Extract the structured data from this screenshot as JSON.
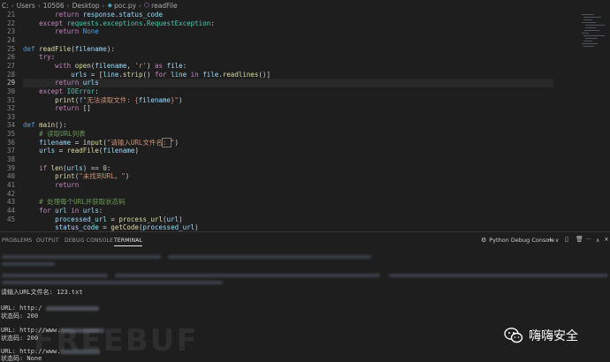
{
  "breadcrumb": {
    "items": [
      "C:",
      "Users",
      "10506",
      "Desktop",
      "poc.py",
      "readFile"
    ]
  },
  "editor": {
    "line_numbers": [
      "21",
      "22",
      "23",
      "24",
      "25",
      "26",
      "27",
      "28",
      "29",
      "30",
      "31",
      "32",
      "33",
      "34",
      "35",
      "36",
      "37",
      "38",
      "39",
      "40",
      "41",
      "42",
      "43",
      "44",
      "45"
    ],
    "current_line": "29"
  },
  "panel": {
    "tabs": [
      "PROBLEMS",
      "OUTPUT",
      "DEBUG CONSOLE",
      "TERMINAL"
    ],
    "active_tab": "TERMINAL",
    "debug_config": "Python Debug Console",
    "tools": [
      "+",
      "∨",
      "▯",
      "🗑",
      "···",
      "∧",
      "×"
    ]
  },
  "terminal": {
    "prompt_line": "请输入URL文件名: 123.txt",
    "results": [
      {
        "url": "URL: http:/",
        "status": "状态码: 200"
      },
      {
        "url": "URL: http://www.",
        "status": "状态码: 200"
      },
      {
        "url": "URL: http://www.",
        "status": "状态码: None"
      }
    ]
  },
  "watermarks": {
    "site": "FREEBUF",
    "account": "嗨嗨安全"
  }
}
